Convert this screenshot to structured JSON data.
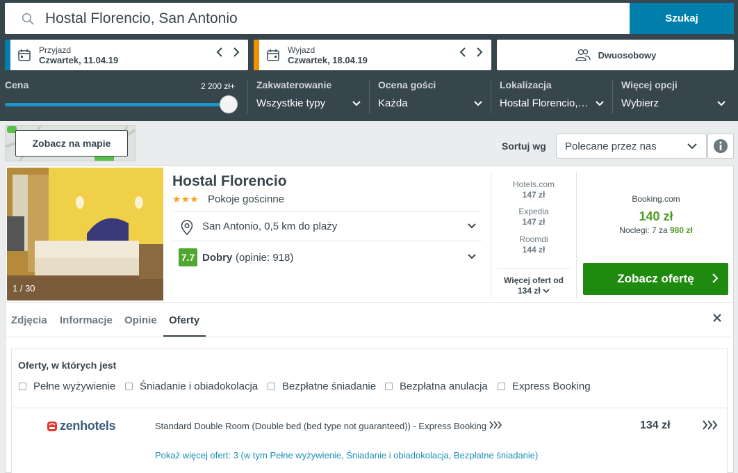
{
  "search": {
    "query": "Hostal Florencio, San Antonio",
    "button_label": "Szukaj"
  },
  "checkin": {
    "label": "Przyjazd",
    "value": "Czwartek, 11.04.19"
  },
  "checkout": {
    "label": "Wyjazd",
    "value": "Czwartek, 18.04.19"
  },
  "date_arrows": {
    "prev": "‹",
    "next": "›"
  },
  "rooms": {
    "label": "Dwuosobowy"
  },
  "filters": {
    "price": {
      "title": "Cena",
      "max_label": "2 200 zł+",
      "slider_fraction": 1.0
    },
    "accommodation": {
      "title": "Zakwaterowanie",
      "value": "Wszystkie typy"
    },
    "guest_rating": {
      "title": "Ocena gości",
      "value": "Każda"
    },
    "location": {
      "title": "Lokalizacja",
      "value": "Hostal Florencio,…"
    },
    "more": {
      "title": "Więcej opcji",
      "value": "Wybierz"
    }
  },
  "map": {
    "button_label": "Zobacz na mapie"
  },
  "sort": {
    "label": "Sortuj wg",
    "value": "Polecane przez nas"
  },
  "hotel": {
    "photo_counter": "1 / 30",
    "name": "Hostal Florencio",
    "stars": "★★★",
    "star_count": 3,
    "type": "Pokoje gościnne",
    "location": "San Antonio, 0,5 km do plaży",
    "rating_score": "7.7",
    "rating_word": "Dobry",
    "rating_count": "(opinie: 918)"
  },
  "other_offers": [
    {
      "name": "Hotels.com",
      "price": "147 zł"
    },
    {
      "name": "Expedia",
      "price": "147 zł"
    },
    {
      "name": "Roomdi",
      "price": "144 zł"
    }
  ],
  "more_offers": {
    "line1": "Więcej ofert od",
    "line2": "134 zł"
  },
  "best_deal": {
    "provider": "Booking.com",
    "price": "140 zł",
    "nights_text": "Noclegi: 7 za",
    "nights_total": "980 zł",
    "button_label": "Zobacz ofertę"
  },
  "tabs": [
    {
      "label": "Zdjęcia"
    },
    {
      "label": "Informacje"
    },
    {
      "label": "Opinie"
    },
    {
      "label": "Oferty"
    }
  ],
  "offers_panel": {
    "title": "Oferty, w których jest",
    "checkboxes": [
      "Pełne wyżywienie",
      "Śniadanie i obiadokolacja",
      "Bezpłatne śniadanie",
      "Bezpłatna anulacja",
      "Express Booking"
    ],
    "offer": {
      "provider_logo": "zenhotels",
      "room": "Standard Double Room (Double bed (bed type not guaranteed)) - Express Booking",
      "price": "134 zł",
      "more_link": "Pokaż więcej ofert: 3 (w tym Pełne wyżywienie, Śniadanie i obiadokolacja, Bezpłatne śniadanie)"
    }
  },
  "colors": {
    "header_bg": "#37454d",
    "search_button": "#007fad",
    "checkin_strip": "#007fad",
    "checkout_strip": "#f48f00",
    "rating_badge": "#4fa72f",
    "deal_button": "#1e8a0f",
    "price_green": "#4b9e22",
    "link_blue": "#1a8fb8"
  }
}
